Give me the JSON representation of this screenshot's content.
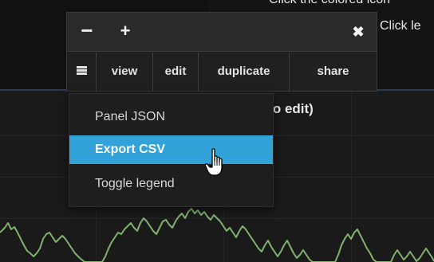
{
  "background": {
    "instruction_line_1": "Click the colored icon",
    "instruction_line_2": "Click le",
    "panel_title": "e to edit)"
  },
  "panel_menu": {
    "minus_icon": "minus-icon",
    "plus_icon": "plus-icon",
    "close_icon": "close-icon",
    "list_icon": "list-icon",
    "buttons": {
      "view": "view",
      "edit": "edit",
      "duplicate": "duplicate",
      "share": "share"
    }
  },
  "dropdown": {
    "items": [
      {
        "label": "Panel JSON"
      },
      {
        "label": "Export CSV",
        "active": true
      },
      {
        "label": "Toggle legend"
      }
    ]
  },
  "colors": {
    "accent": "#33a2d9",
    "series": "#7eb26d",
    "background": "#141414"
  },
  "cursor": "hand-pointer-cursor"
}
